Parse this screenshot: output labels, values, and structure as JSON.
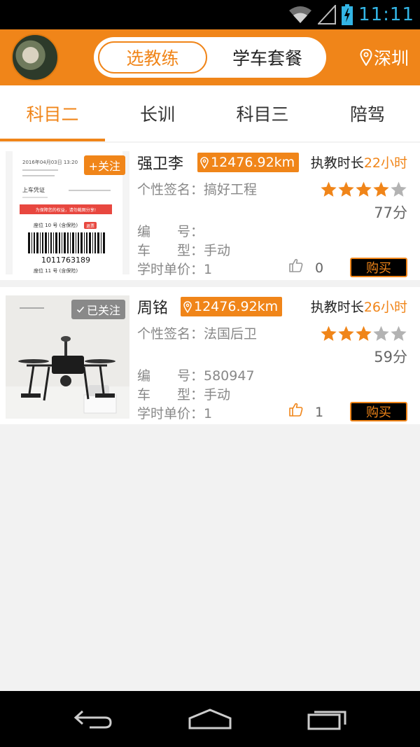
{
  "status_bar": {
    "time": "11:11",
    "icons": [
      "wifi-icon",
      "signal-icon",
      "battery-charging-icon"
    ]
  },
  "header": {
    "segment": {
      "active_label": "选教练",
      "inactive_label": "学车套餐"
    },
    "city": "深圳",
    "icons": [
      "avatar",
      "location-pin-icon"
    ]
  },
  "tabs": {
    "items": [
      "科目二",
      "长训",
      "科目三",
      "陪驾"
    ],
    "active_index": 0
  },
  "coaches": [
    {
      "follow_label": "+关注",
      "name": "强卫李",
      "distance": "12476.92km",
      "hours_label": "执教时长",
      "hours_value": "22小时",
      "signature": "个性签名：搞好工程",
      "rating": 4,
      "score": "77分",
      "number": "编　　号：",
      "car_type": "车　　型：手动",
      "unit_price": "学时单价：1",
      "likes": "0",
      "buy_label": "购买",
      "ticket": {
        "datetime": "2016年04月03日 13:20",
        "title": "上车凭证",
        "banner": "为保障您的权益，请勿截图分享!",
        "seat": "座位 10 号 (含保险)",
        "barcode": "1011763189",
        "seat2": "座位 11 号 (含保险)",
        "tag": "退票"
      }
    },
    {
      "follow_label": "已关注",
      "name": "周铭",
      "distance": "12476.92km",
      "hours_label": "执教时长",
      "hours_value": "26小时",
      "signature": "个性签名：法国后卫",
      "rating": 3,
      "score": "59分",
      "number": "编　　号：580947",
      "car_type": "车　　型：手动",
      "unit_price": "学时单价：1",
      "likes": "1",
      "buy_label": "购买"
    }
  ],
  "colors": {
    "accent": "#f08519",
    "status_time": "#33b5e5",
    "star_off": "#b3b3b3"
  },
  "nav_bar": {
    "icons": [
      "back-icon",
      "home-icon",
      "recent-apps-icon"
    ]
  }
}
